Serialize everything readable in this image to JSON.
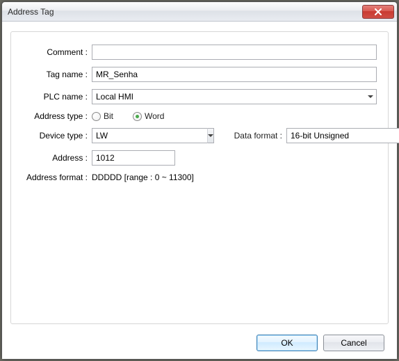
{
  "window": {
    "title": "Address Tag"
  },
  "labels": {
    "comment": "Comment :",
    "tag_name": "Tag name :",
    "plc_name": "PLC name :",
    "address_type": "Address type :",
    "device_type": "Device type :",
    "data_format": "Data format :",
    "address": "Address :",
    "address_format": "Address format :"
  },
  "values": {
    "comment": "",
    "tag_name": "MR_Senha",
    "plc_name": "Local HMI",
    "device_type": "LW",
    "data_format": "16-bit Unsigned",
    "address": "1012",
    "address_format_text": "DDDDD [range : 0 ~ 11300]"
  },
  "address_type": {
    "bit_label": "Bit",
    "word_label": "Word",
    "selected": "word"
  },
  "buttons": {
    "ok": "OK",
    "cancel": "Cancel"
  }
}
